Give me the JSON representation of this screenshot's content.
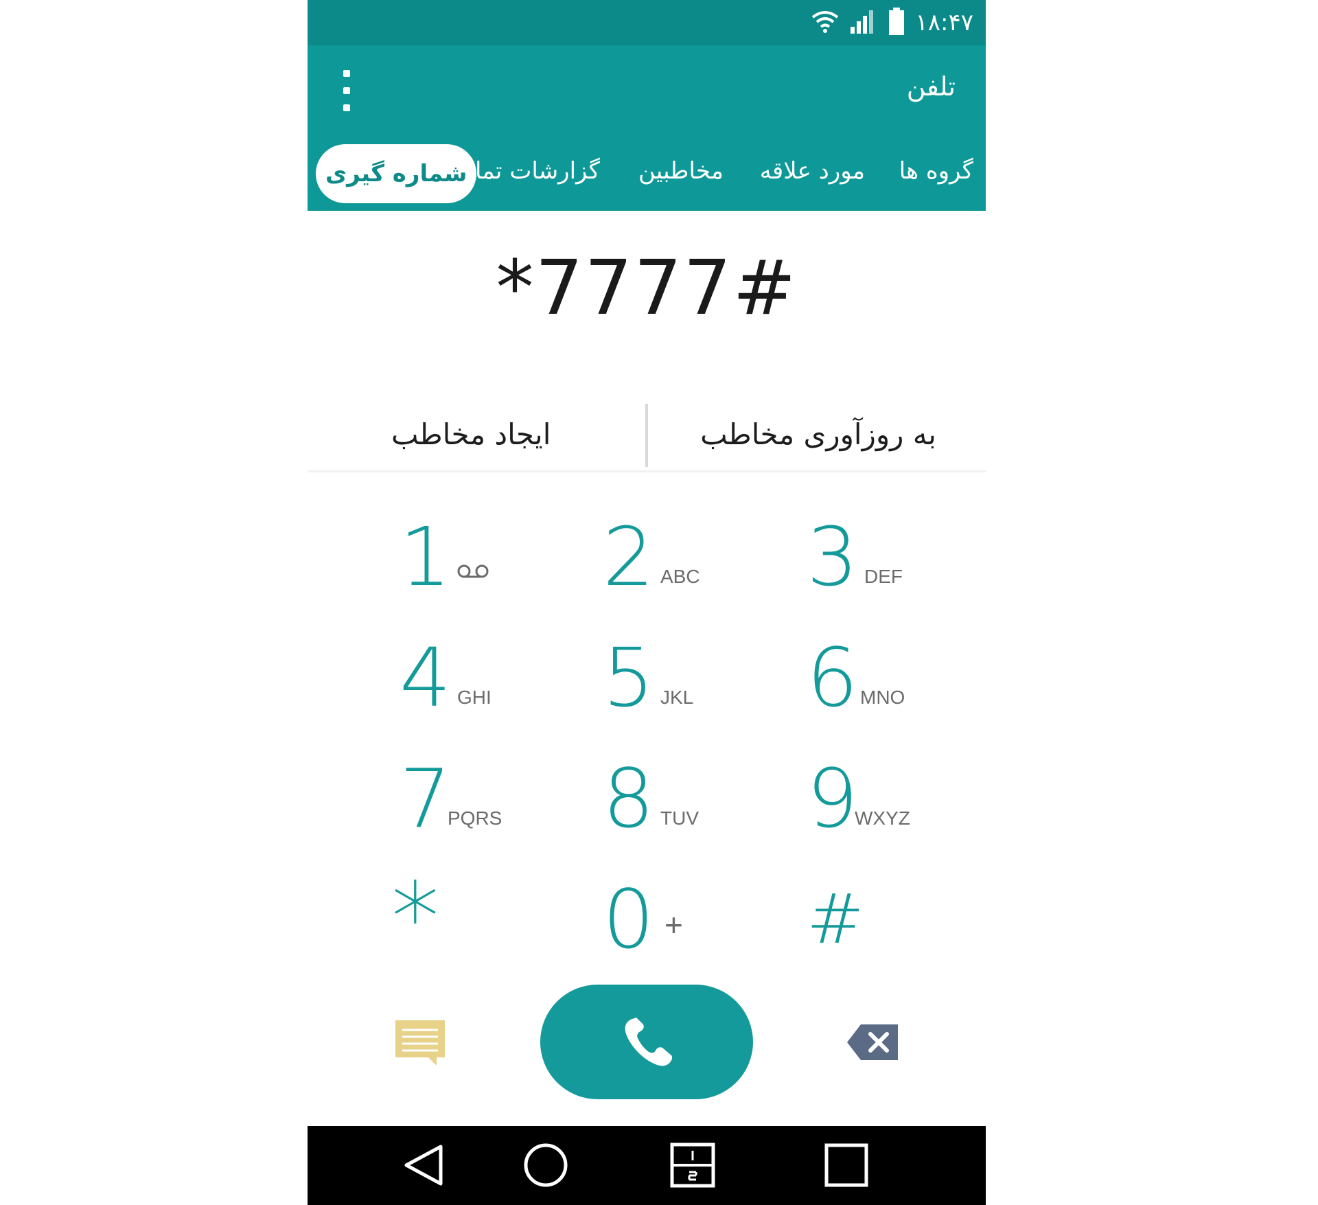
{
  "status_bar": {
    "time": "۱۸:۴۷",
    "icons": [
      "wifi-icon",
      "signal-icon",
      "battery-icon"
    ]
  },
  "app_bar": {
    "title": "تلفن",
    "menu_icon": "overflow-menu-icon"
  },
  "tabs": [
    {
      "label": "گروه ها",
      "active": false
    },
    {
      "label": "مورد علاقه",
      "active": false
    },
    {
      "label": "مخاطبین",
      "active": false
    },
    {
      "label": "گزارشات تماس",
      "active": false
    },
    {
      "label": "شماره گیری",
      "active": true
    }
  ],
  "dialer": {
    "number": "*7777#",
    "update_contact_label": "به روزآوری مخاطب",
    "create_contact_label": "ایجاد مخاطب"
  },
  "keypad": [
    {
      "digit": "1",
      "letters": "voicemail-icon"
    },
    {
      "digit": "2",
      "letters": "ABC"
    },
    {
      "digit": "3",
      "letters": "DEF"
    },
    {
      "digit": "4",
      "letters": "GHI"
    },
    {
      "digit": "5",
      "letters": "JKL"
    },
    {
      "digit": "6",
      "letters": "MNO"
    },
    {
      "digit": "7",
      "letters": "PQRS"
    },
    {
      "digit": "8",
      "letters": "TUV"
    },
    {
      "digit": "9",
      "letters": "WXYZ"
    },
    {
      "digit": "*",
      "letters": ""
    },
    {
      "digit": "0",
      "letters": "+"
    },
    {
      "digit": "#",
      "letters": ""
    }
  ],
  "bottom_actions": {
    "message_icon": "message-icon",
    "call_icon": "phone-icon",
    "delete_icon": "backspace-icon"
  },
  "navigation": [
    "back-icon",
    "home-icon",
    "dual-window-icon",
    "recents-icon"
  ],
  "colors": {
    "status_bar": "#0b8a89",
    "app_bar": "#0e9898",
    "accent": "#149a9a",
    "message": "#e8d28a",
    "backspace": "#5c6b85"
  }
}
